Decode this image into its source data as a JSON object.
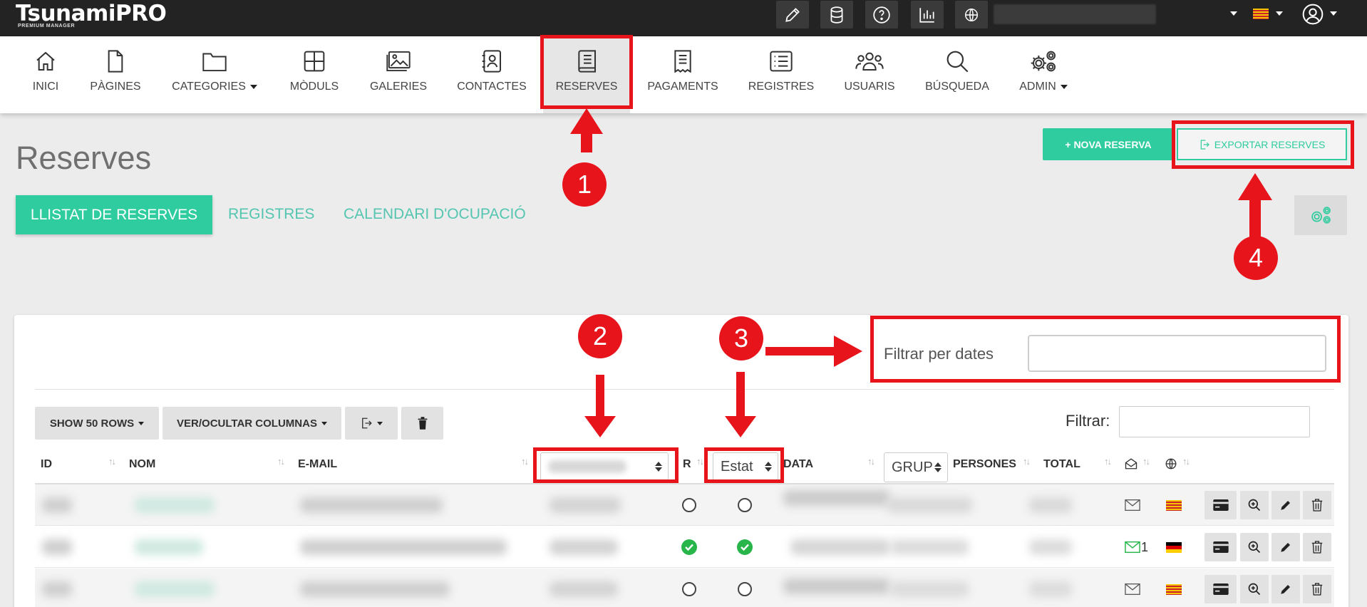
{
  "app": {
    "logo": "TsunamiPRO",
    "logo_sub": "PREMIUM MANAGER"
  },
  "nav": {
    "items": [
      {
        "label": "INICI",
        "icon": "home-icon"
      },
      {
        "label": "PÀGINES",
        "icon": "file-icon"
      },
      {
        "label": "CATEGORIES",
        "icon": "folder-icon",
        "dropdown": true
      },
      {
        "label": "MÒDULS",
        "icon": "grid-icon"
      },
      {
        "label": "GALERIES",
        "icon": "images-icon"
      },
      {
        "label": "CONTACTES",
        "icon": "contacts-icon"
      },
      {
        "label": "RESERVES",
        "icon": "book-icon",
        "active": true
      },
      {
        "label": "PAGAMENTS",
        "icon": "receipt-icon"
      },
      {
        "label": "REGISTRES",
        "icon": "list-icon"
      },
      {
        "label": "USUARIS",
        "icon": "users-icon"
      },
      {
        "label": "BÚSQUEDA",
        "icon": "search-icon"
      },
      {
        "label": "ADMIN",
        "icon": "gears-icon",
        "dropdown": true
      }
    ]
  },
  "page": {
    "title": "Reserves",
    "btn_nova": "+ NOVA RESERVA",
    "btn_export": "EXPORTAR RESERVES",
    "tabs": [
      "LLISTAT DE RESERVES",
      "REGISTRES",
      "CALENDARI D'OCUPACIÓ"
    ]
  },
  "annotations": {
    "n1": "1",
    "n2": "2",
    "n3": "3",
    "n4": "4"
  },
  "table": {
    "date_filter_label": "Filtrar per dates",
    "filter_label": "Filtrar:",
    "btn_rows": "SHOW 50 ROWS",
    "btn_columns": "VER/OCULTAR COLUMNAS",
    "headers": {
      "id": "ID",
      "nom": "NOM",
      "email": "E-MAIL",
      "r": "R",
      "estat": "Estat",
      "data": "DATA",
      "grup": "GRUP",
      "persones": "PERSONES",
      "total": "TOTAL"
    },
    "rows": [
      {
        "r_checked": false,
        "estat_checked": false,
        "mail_count": "",
        "lang": "ca"
      },
      {
        "r_checked": true,
        "estat_checked": true,
        "mail_count": "1",
        "lang": "de"
      },
      {
        "r_checked": false,
        "estat_checked": false,
        "mail_count": "",
        "lang": "ca"
      }
    ]
  },
  "colors": {
    "accent": "#2ecc9e",
    "annotation": "#e8141c",
    "topbar": "#232323",
    "check": "#28b54a"
  }
}
